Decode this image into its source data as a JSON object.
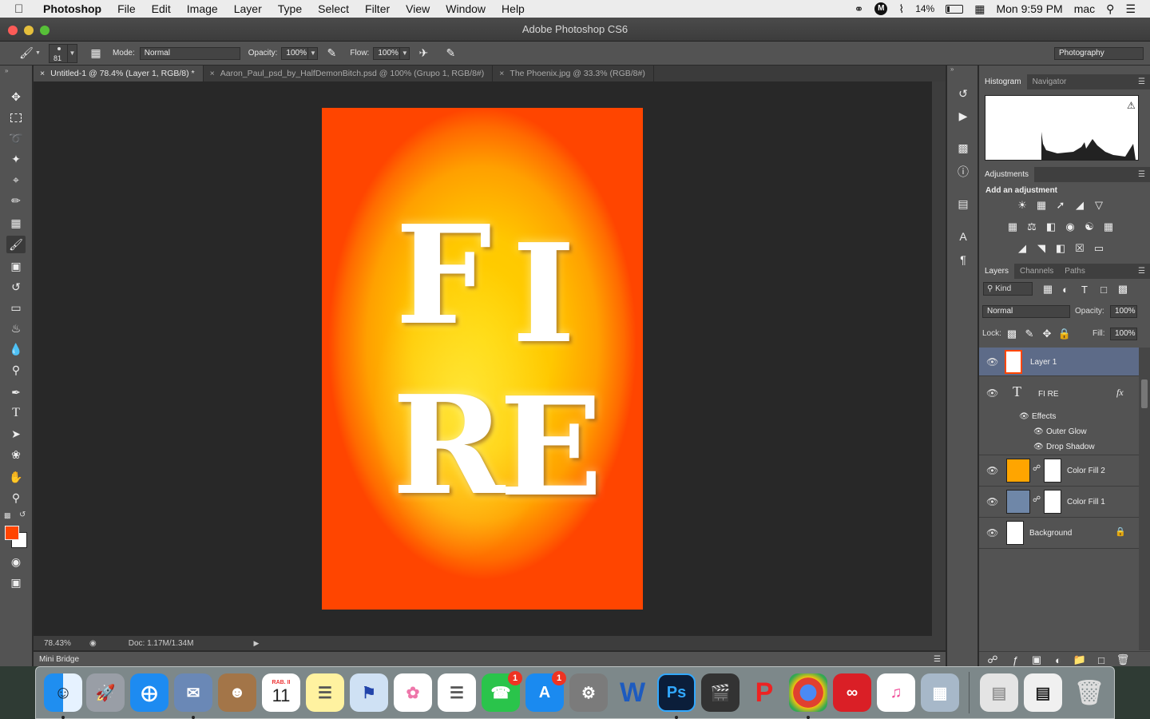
{
  "menubar": {
    "app_name": "Photoshop",
    "items": [
      "File",
      "Edit",
      "Image",
      "Layer",
      "Type",
      "Select",
      "Filter",
      "View",
      "Window",
      "Help"
    ],
    "battery": "14%",
    "clock": "Mon 9:59 PM",
    "user": "mac"
  },
  "window": {
    "title": "Adobe Photoshop CS6"
  },
  "options": {
    "brush_size": "81",
    "mode_label": "Mode:",
    "mode_value": "Normal",
    "opacity_label": "Opacity:",
    "opacity_value": "100%",
    "flow_label": "Flow:",
    "flow_value": "100%",
    "workspace": "Photography"
  },
  "tabs": [
    {
      "label": "Untitled-1 @ 78.4% (Layer 1, RGB/8) *",
      "active": true
    },
    {
      "label": "Aaron_Paul_psd_by_HalfDemonBitch.psd @ 100% (Grupo 1, RGB/8#)",
      "active": false
    },
    {
      "label": "The Phoenix.jpg @ 33.3% (RGB/8#)",
      "active": false
    }
  ],
  "canvas": {
    "letters": [
      "F",
      "I",
      "R",
      "E"
    ]
  },
  "status": {
    "zoom": "78.43%",
    "doc": "Doc: 1.17M/1.34M"
  },
  "mini_bridge": "Mini Bridge",
  "histogram_panel": {
    "tabs": [
      "Histogram",
      "Navigator"
    ]
  },
  "adjustments_panel": {
    "title": "Adjustments",
    "subtitle": "Add an adjustment"
  },
  "layers_panel": {
    "tabs": [
      "Layers",
      "Channels",
      "Paths"
    ],
    "kind": "Kind",
    "blend": "Normal",
    "opacity_label": "Opacity:",
    "opacity_value": "100%",
    "lock_label": "Lock:",
    "fill_label": "Fill:",
    "fill_value": "100%",
    "layers": [
      {
        "name": "Layer 1"
      },
      {
        "name": "FI RE"
      },
      {
        "name": "Effects"
      },
      {
        "name": "Outer Glow"
      },
      {
        "name": "Drop Shadow"
      },
      {
        "name": "Color Fill 2"
      },
      {
        "name": "Color Fill 1"
      },
      {
        "name": "Background"
      }
    ],
    "fx": "fx"
  },
  "colors": {
    "foreground": "#ff4500",
    "background": "#ffffff",
    "selected_layer": "#5d6b88"
  },
  "dock": {
    "calendar_month": "RAB. II",
    "calendar_day": "11",
    "facetime_badge": "1",
    "appstore_badge": "1",
    "ps_label": "Ps"
  }
}
